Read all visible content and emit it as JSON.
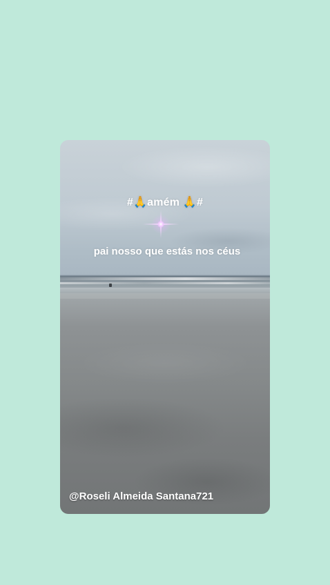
{
  "story": {
    "hashtag": "#🙏amém 🙏#",
    "caption": "pai nosso que estás nos céus",
    "username": "@Roseli Almeida Santana721"
  },
  "icons": {
    "sparkle": "sparkle-icon"
  },
  "colors": {
    "background": "#bfe9da",
    "text": "#ffffff",
    "sparkle": "#f2c8ff"
  }
}
